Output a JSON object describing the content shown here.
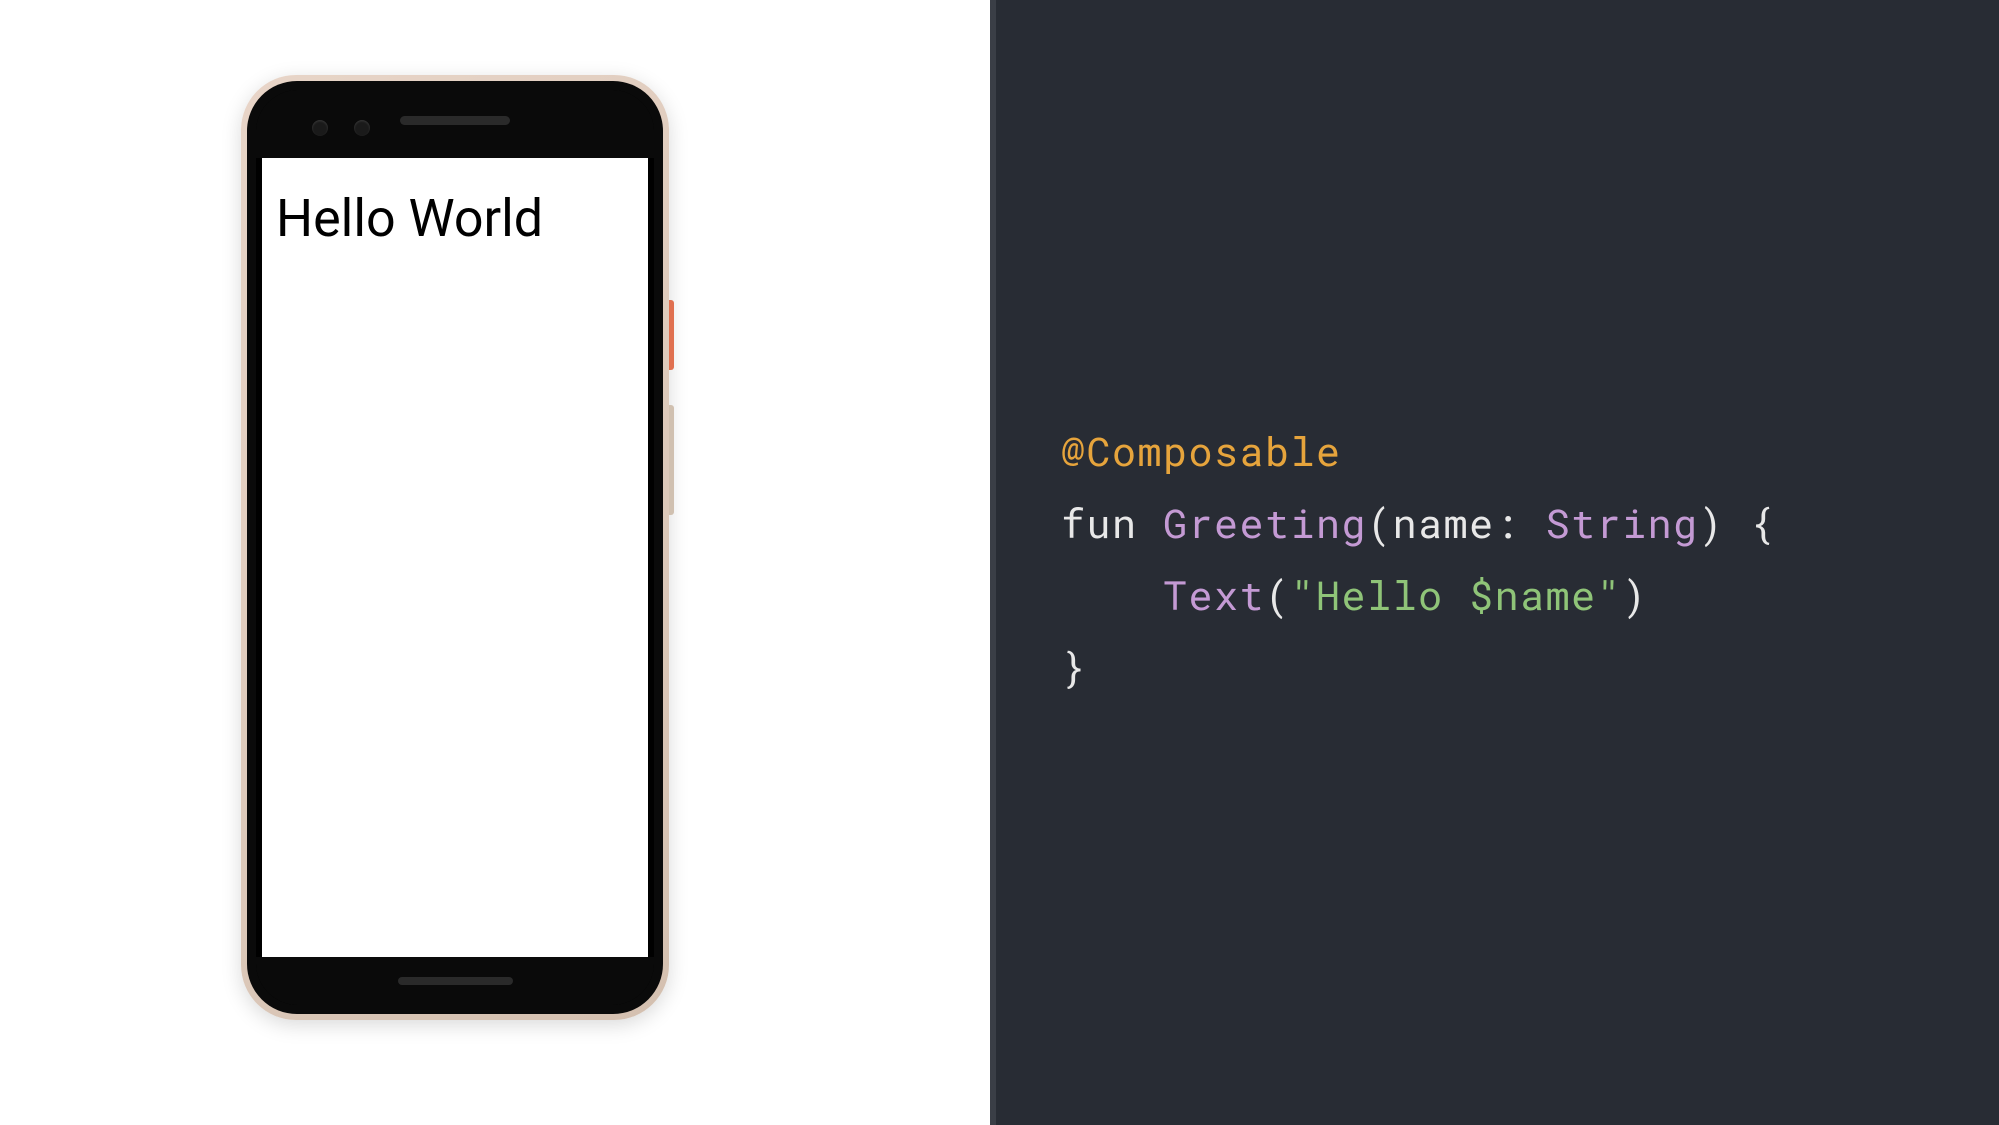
{
  "preview": {
    "screen_text": "Hello World"
  },
  "code": {
    "annotation": "@Composable",
    "keyword_fun": "fun",
    "function_name": "Greeting",
    "param_name": "name",
    "param_colon": ":",
    "param_type": "String",
    "open_paren": "(",
    "close_paren": ")",
    "open_brace": "{",
    "close_brace": "}",
    "call_name": "Text",
    "string_literal": "\"Hello $name\"",
    "indent": "    "
  },
  "colors": {
    "code_bg": "#282c34",
    "annotation": "#e6a43c",
    "function": "#c49ad4",
    "type": "#c49ad4",
    "string": "#8fc478",
    "default": "#e8e8e8"
  }
}
